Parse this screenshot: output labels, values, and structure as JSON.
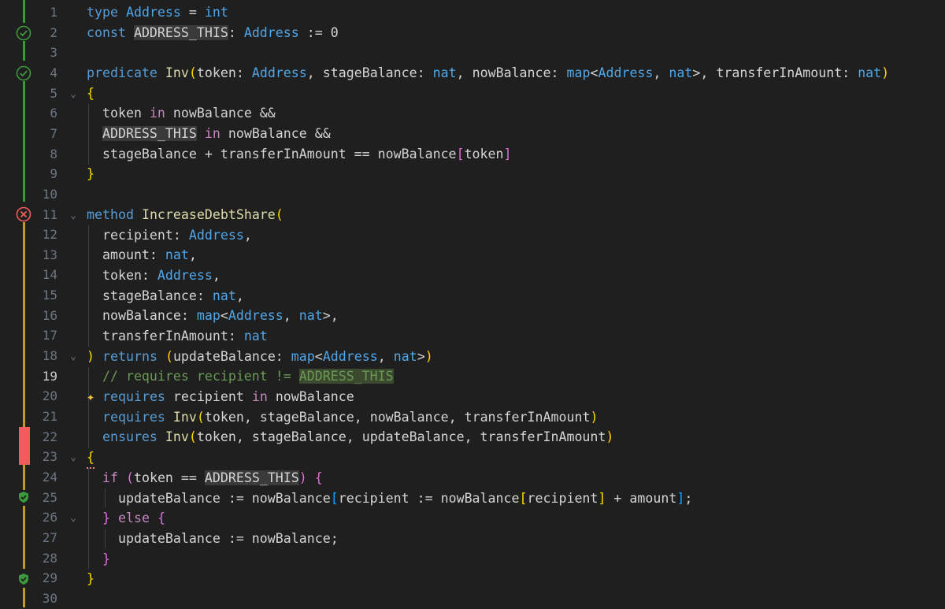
{
  "editor": {
    "active_line": 19,
    "lines": [
      {
        "n": "1"
      },
      {
        "n": "2"
      },
      {
        "n": "3"
      },
      {
        "n": "4"
      },
      {
        "n": "5"
      },
      {
        "n": "6"
      },
      {
        "n": "7"
      },
      {
        "n": "8"
      },
      {
        "n": "9"
      },
      {
        "n": "10"
      },
      {
        "n": "11"
      },
      {
        "n": "12"
      },
      {
        "n": "13"
      },
      {
        "n": "14"
      },
      {
        "n": "15"
      },
      {
        "n": "16"
      },
      {
        "n": "17"
      },
      {
        "n": "18"
      },
      {
        "n": "19"
      },
      {
        "n": "20"
      },
      {
        "n": "21"
      },
      {
        "n": "22"
      },
      {
        "n": "23"
      },
      {
        "n": "24"
      },
      {
        "n": "25"
      },
      {
        "n": "26"
      },
      {
        "n": "27"
      },
      {
        "n": "28"
      },
      {
        "n": "29"
      },
      {
        "n": "30"
      }
    ],
    "code": {
      "l1": {
        "t1": "type",
        "t2": " ",
        "t3": "Address",
        "t4": " = ",
        "t5": "int"
      },
      "l2": {
        "t1": "const",
        "t2": " ",
        "t3": "ADDRESS_THIS",
        "t4": ": ",
        "t5": "Address",
        "t6": " := 0"
      },
      "l4": {
        "t1": "predicate",
        "t2": " ",
        "t3": "Inv",
        "t4": "(",
        "t5": "token: ",
        "t6": "Address",
        "t7": ", stageBalance: ",
        "t8": "nat",
        "t9": ", nowBalance: ",
        "t10": "map",
        "t11": "<",
        "t12": "Address",
        "t13": ", ",
        "t14": "nat",
        "t15": ">, transferInAmount: ",
        "t16": "nat",
        "t17": ")"
      },
      "l5": {
        "t1": "{"
      },
      "l6": {
        "t1": "token ",
        "t2": "in",
        "t3": " nowBalance &&"
      },
      "l7": {
        "t1": "ADDRESS_THIS",
        "t2": " ",
        "t3": "in",
        "t4": " nowBalance &&"
      },
      "l8": {
        "t1": "stageBalance + transferInAmount == nowBalance",
        "t2": "[",
        "t3": "token",
        "t4": "]"
      },
      "l9": {
        "t1": "}"
      },
      "l11": {
        "t1": "method",
        "t2": " ",
        "t3": "IncreaseDebtShare",
        "t4": "("
      },
      "l12": {
        "t1": "recipient: ",
        "t2": "Address",
        "t3": ","
      },
      "l13": {
        "t1": "amount: ",
        "t2": "nat",
        "t3": ","
      },
      "l14": {
        "t1": "token: ",
        "t2": "Address",
        "t3": ","
      },
      "l15": {
        "t1": "stageBalance: ",
        "t2": "nat",
        "t3": ","
      },
      "l16": {
        "t1": "nowBalance: ",
        "t2": "map",
        "t3": "<",
        "t4": "Address",
        "t5": ", ",
        "t6": "nat",
        "t7": ">,"
      },
      "l17": {
        "t1": "transferInAmount: ",
        "t2": "nat"
      },
      "l18": {
        "t1": ")",
        "t2": " ",
        "t3": "returns",
        "t4": " ",
        "t5": "(",
        "t6": "updateBalance: ",
        "t7": "map",
        "t8": "<",
        "t9": "Address",
        "t10": ", ",
        "t11": "nat",
        "t12": ">",
        "t13": ")"
      },
      "l19": {
        "t1": "// requires recipient != ",
        "t2": "ADDRESS_THIS"
      },
      "l20": {
        "t0": "✦",
        "t1": "requires",
        "t2": " recipient ",
        "t3": "in",
        "t4": " nowBalance"
      },
      "l21": {
        "t1": "requires",
        "t2": " ",
        "t3": "Inv",
        "t4": "(",
        "t5": "token, stageBalance, nowBalance, transferInAmount",
        "t6": ")"
      },
      "l22": {
        "t1": "ensures",
        "t2": " ",
        "t3": "Inv",
        "t4": "(",
        "t5": "token, stageBalance, updateBalance, transferInAmount",
        "t6": ")"
      },
      "l23": {
        "t1": "{"
      },
      "l24": {
        "t1": "if",
        "t2": " ",
        "t3": "(",
        "t4": "token == ",
        "t5": "ADDRESS_THIS",
        "t6": ")",
        "t7": " ",
        "t8": "{"
      },
      "l25": {
        "t1": "updateBalance := nowBalance",
        "t2": "[",
        "t3": "recipient := nowBalance",
        "t4": "[",
        "t5": "recipient",
        "t6": "]",
        "t7": " + amount",
        "t8": "]",
        "t9": ";"
      },
      "l26": {
        "t1": "}",
        "t2": " ",
        "t3": "else",
        "t4": " ",
        "t5": "{"
      },
      "l27": {
        "t1": "updateBalance := nowBalance;"
      },
      "l28": {
        "t1": "}"
      },
      "l29": {
        "t1": "}"
      }
    }
  },
  "colors": {
    "background": "#1f1f1f",
    "verified": "#3c9a3c",
    "error": "#f25c5c",
    "warning": "#b89e27"
  }
}
